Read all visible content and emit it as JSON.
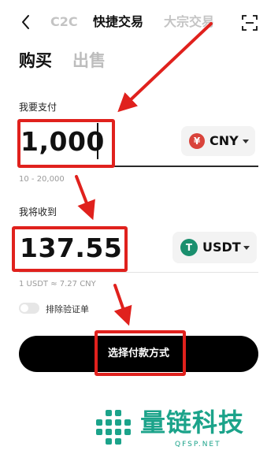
{
  "header": {
    "tabs": [
      "C2C",
      "快捷交易",
      "大宗交易"
    ]
  },
  "mode": {
    "buy": "购买",
    "sell": "出售"
  },
  "pay": {
    "label": "我要支付",
    "amount": "1,000",
    "currency": "CNY",
    "currency_glyph": "¥",
    "range": "10 - 20,000"
  },
  "receive": {
    "label": "我将收到",
    "amount": "137.55",
    "currency": "USDT",
    "currency_glyph": "T",
    "rate": "1 USDT ≈ 7.27 CNY"
  },
  "toggle": {
    "label": "排除验证单",
    "on": false
  },
  "action": {
    "label": "选择付款方式"
  },
  "watermark": {
    "name": "量链科技",
    "domain": "QFSP.NET"
  },
  "colors": {
    "annotation": "#e0211d",
    "cny_badge": "#d9433b",
    "usdt_badge": "#1a8f6e",
    "watermark": "#1ba38a"
  }
}
